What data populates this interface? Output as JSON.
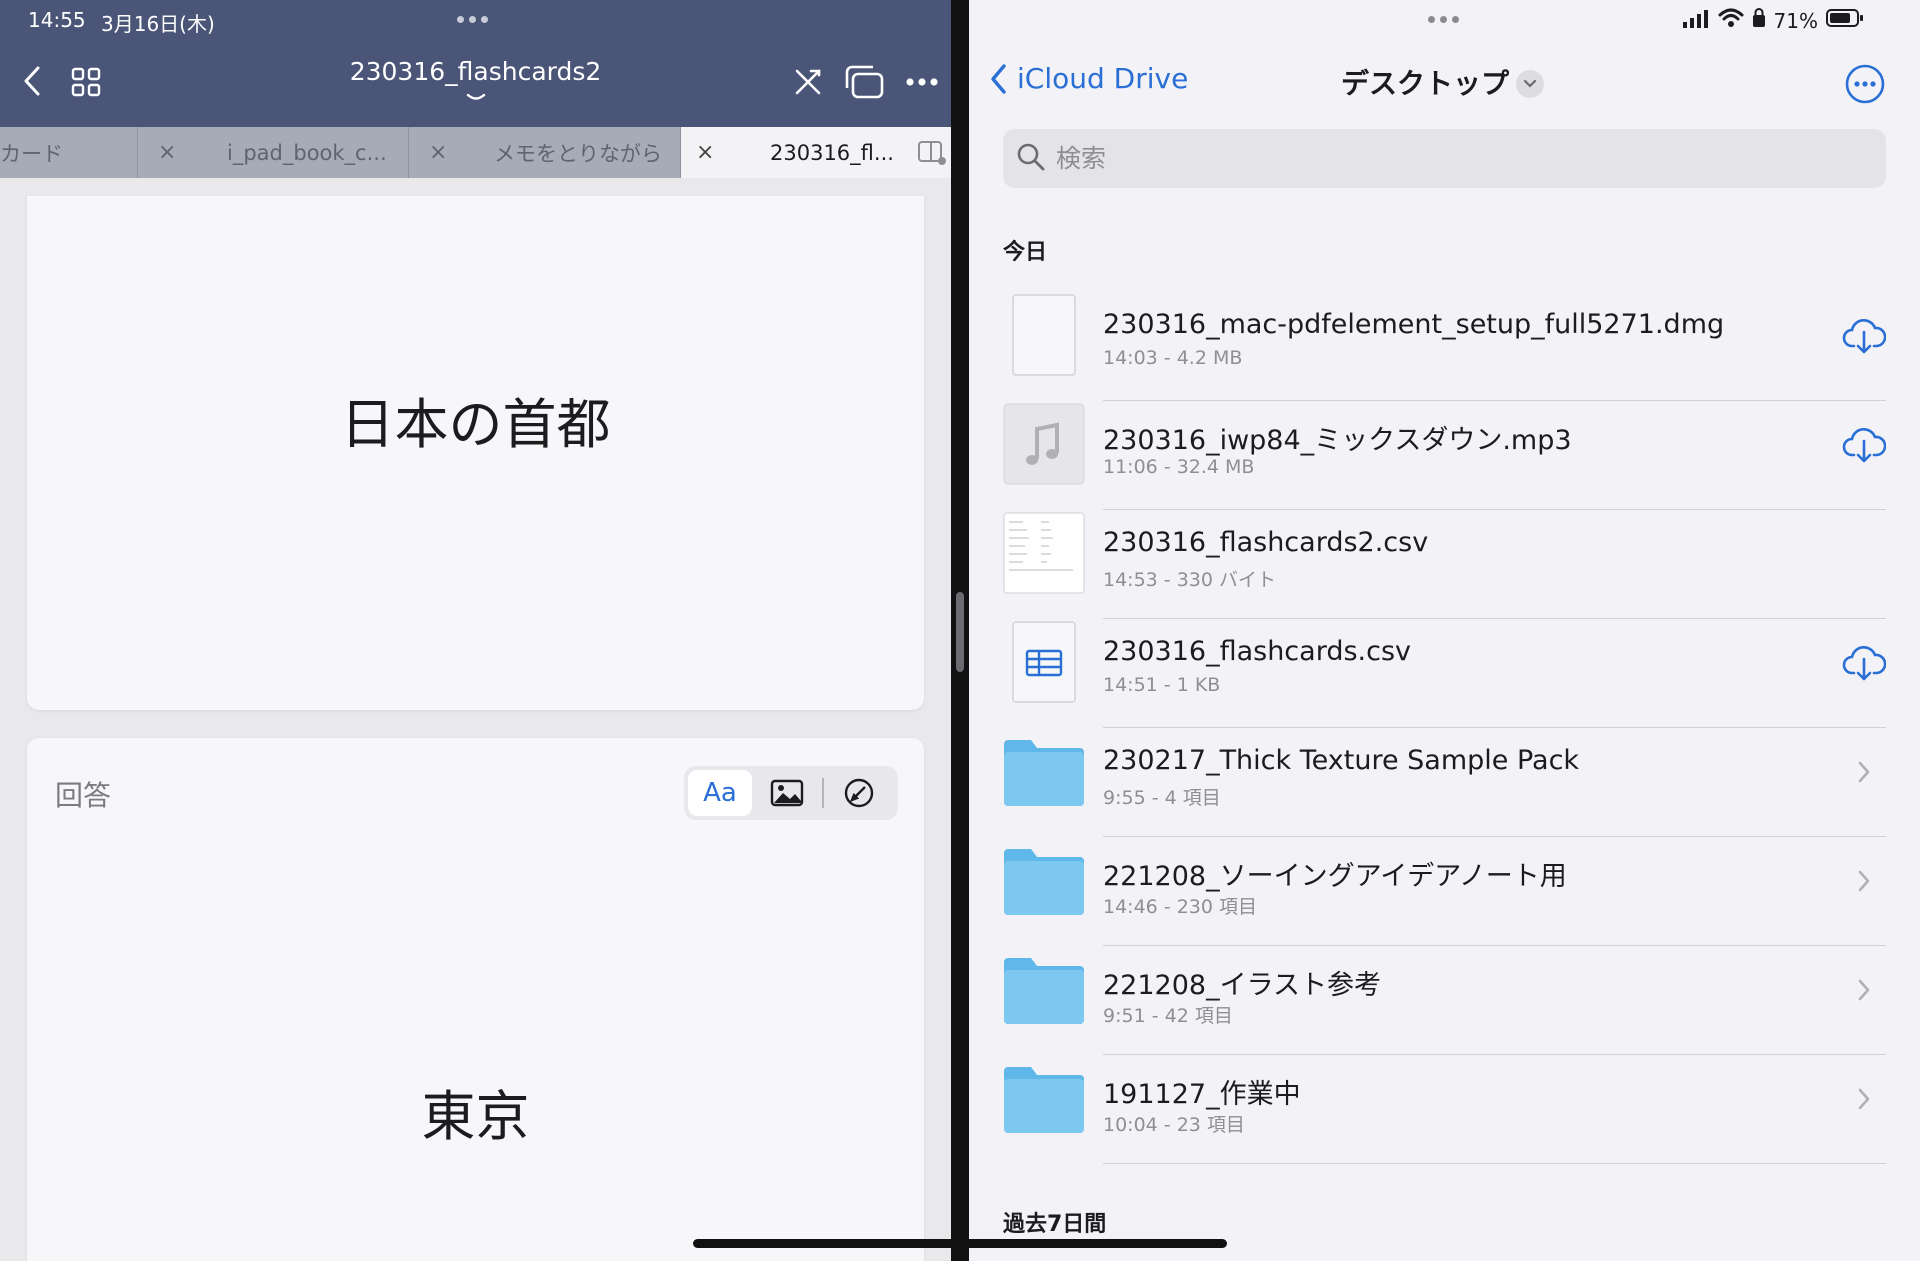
{
  "left": {
    "status": {
      "time": "14:55",
      "date": "3月16日(木)"
    },
    "title": "230316_flashcards2",
    "tabs": [
      {
        "label": "カード",
        "active": false,
        "close": ""
      },
      {
        "label": "i_pad_book_c...",
        "active": false,
        "close": "×"
      },
      {
        "label": "メモをとりながら",
        "active": false,
        "close": "×"
      },
      {
        "label": "230316_fl...",
        "active": true,
        "close": "×"
      }
    ],
    "question": "日本の首都",
    "answer_label": "回答",
    "answer_format_label": "Aa",
    "answer": "東京"
  },
  "right": {
    "status": {
      "battery": "71%"
    },
    "back_label": "iCloud Drive",
    "folder_title": "デスクトップ",
    "search_placeholder": "検索",
    "sections": [
      {
        "title": "今日",
        "items": [
          {
            "name": "230316_mac-pdfelement_setup_full5271.dmg",
            "meta": "14:03 - 4.2 MB",
            "kind": "file-blank",
            "action": "download"
          },
          {
            "name": "230316_iwp84_ミックスダウン.mp3",
            "meta": "11:06 - 32.4 MB",
            "kind": "audio",
            "action": "download"
          },
          {
            "name": "230316_flashcards2.csv",
            "meta": "14:53 - 330 バイト",
            "kind": "csv-preview",
            "action": ""
          },
          {
            "name": "230316_flashcards.csv",
            "meta": "14:51 - 1 KB",
            "kind": "table",
            "action": "download"
          },
          {
            "name": "230217_Thick Texture Sample Pack",
            "meta": "9:55 - 4 項目",
            "kind": "folder",
            "action": "open"
          },
          {
            "name": "221208_ソーイングアイデアノート用",
            "meta": "14:46 - 230 項目",
            "kind": "folder",
            "action": "open"
          },
          {
            "name": "221208_イラスト参考",
            "meta": "9:51 - 42 項目",
            "kind": "folder",
            "action": "open"
          },
          {
            "name": "191127_作業中",
            "meta": "10:04 - 23 項目",
            "kind": "folder",
            "action": "open"
          }
        ]
      },
      {
        "title": "過去7日間",
        "items": []
      }
    ]
  },
  "colors": {
    "accent": "#2a6fd6",
    "header_bg": "#4a5578",
    "folder": "#7cc8f0"
  }
}
